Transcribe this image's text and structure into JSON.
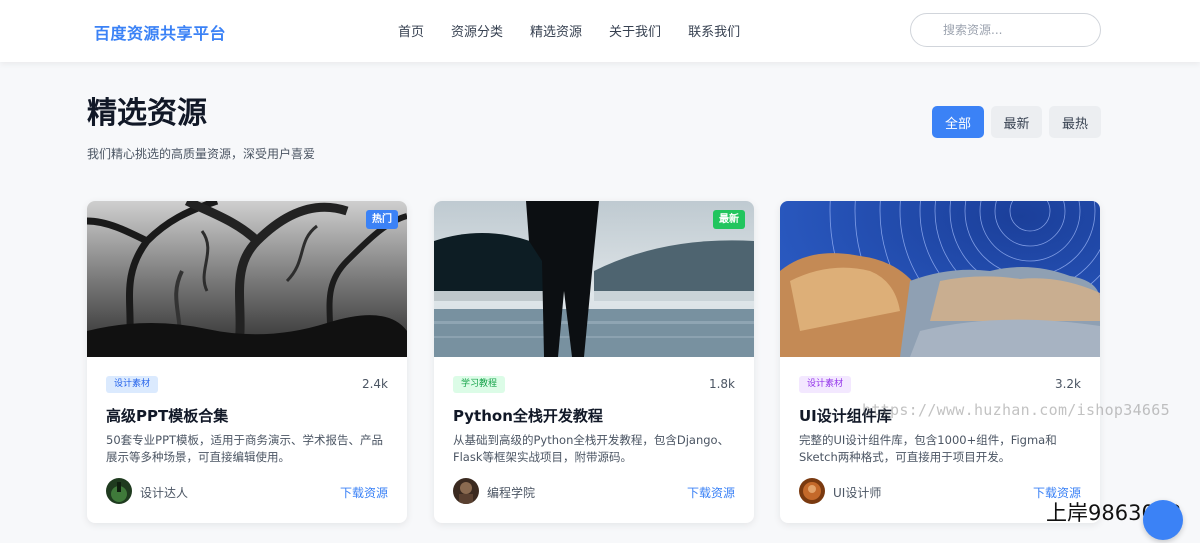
{
  "header": {
    "logo": "百度资源共享平台",
    "nav": [
      "首页",
      "资源分类",
      "精选资源",
      "关于我们",
      "联系我们"
    ],
    "search_placeholder": "搜索资源..."
  },
  "section": {
    "title": "精选资源",
    "subtitle": "我们精心挑选的高质量资源，深受用户喜爱",
    "filters": [
      "全部",
      "最新",
      "最热"
    ],
    "active_filter": "全部"
  },
  "cards": [
    {
      "badge": "热门",
      "tag": "设计素材",
      "count": "2.4k",
      "title": "高级PPT模板合集",
      "desc": "50套专业PPT模板，适用于商务演示、学术报告、产品展示等多种场景，可直接编辑使用。",
      "author": "设计达人",
      "action": "下载资源"
    },
    {
      "badge": "最新",
      "tag": "学习教程",
      "count": "1.8k",
      "title": "Python全栈开发教程",
      "desc": "从基础到高级的Python全栈开发教程，包含Django、Flask等框架实战项目，附带源码。",
      "author": "编程学院",
      "action": "下载资源"
    },
    {
      "badge": "",
      "tag": "设计素材",
      "count": "3.2k",
      "title": "UI设计组件库",
      "desc": "完整的UI设计组件库，包含1000+组件，Figma和Sketch两种格式，可直接用于项目开发。",
      "author": "UI设计师",
      "action": "下载资源"
    }
  ],
  "overlay": {
    "watermark": "https://www.huzhan.com/ishop34665",
    "corner_text": "上岸9863003"
  },
  "colors": {
    "primary": "#3b82f6",
    "badge_new": "#22c55e"
  }
}
